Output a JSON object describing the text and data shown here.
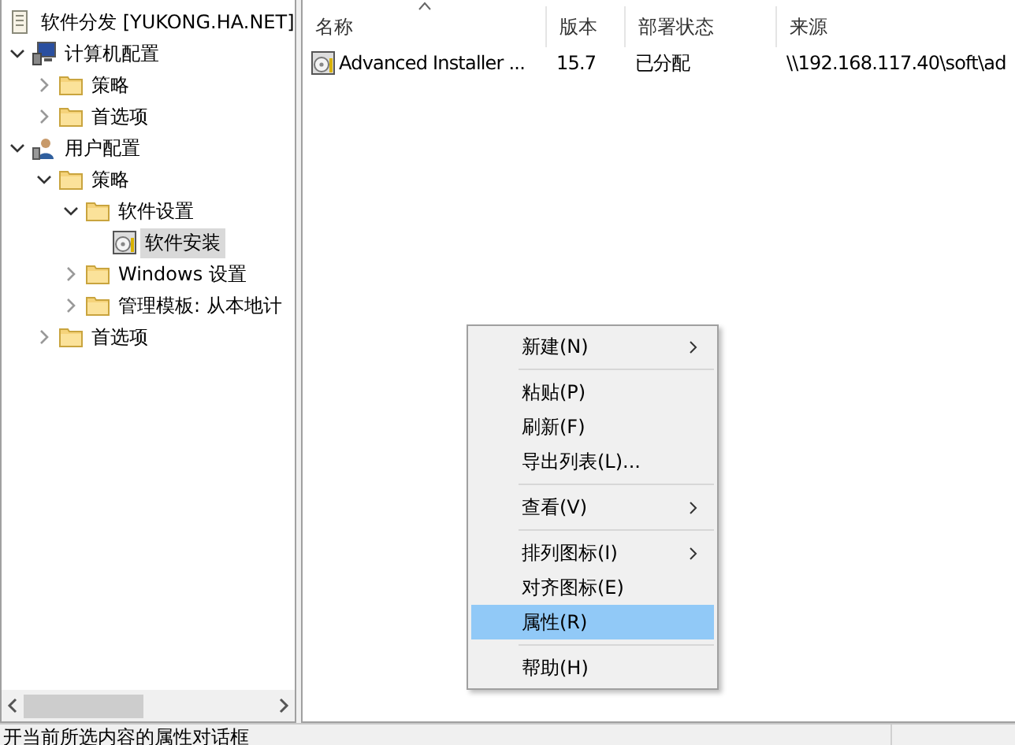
{
  "tree": {
    "label": "软件分发 [YUKONG.HA.NET]",
    "kind": "document",
    "children": [
      {
        "label": "计算机配置",
        "kind": "computer",
        "expanded": true,
        "selected": false,
        "children": [
          {
            "label": "策略",
            "kind": "folder",
            "expanded": false,
            "selected": false
          },
          {
            "label": "首选项",
            "kind": "folder",
            "expanded": false,
            "selected": false
          }
        ]
      },
      {
        "label": "用户配置",
        "kind": "user",
        "expanded": true,
        "selected": false,
        "children": [
          {
            "label": "策略",
            "kind": "folder",
            "expanded": true,
            "selected": false,
            "children": [
              {
                "label": "软件设置",
                "kind": "folder",
                "expanded": true,
                "selected": false,
                "children": [
                  {
                    "label": "软件安装",
                    "kind": "software",
                    "selected": true
                  }
                ]
              },
              {
                "label": "Windows 设置",
                "kind": "folder",
                "expanded": false,
                "selected": false
              },
              {
                "label": "管理模板: 从本地计",
                "kind": "folder",
                "expanded": false,
                "selected": false
              }
            ]
          },
          {
            "label": "首选项",
            "kind": "folder",
            "expanded": false,
            "selected": false
          }
        ]
      }
    ]
  },
  "table": {
    "columns": [
      {
        "label": "名称",
        "sorted": true
      },
      {
        "label": "版本",
        "sorted": false
      },
      {
        "label": "部署状态",
        "sorted": false
      },
      {
        "label": "来源",
        "sorted": false
      }
    ],
    "rows": [
      {
        "cells": [
          "Advanced Installer ...",
          "15.7",
          "已分配",
          "\\\\192.168.117.40\\soft\\ad"
        ]
      }
    ]
  },
  "context_menu": [
    {
      "kind": "item",
      "label": "新建(N)",
      "submenu": true,
      "selected": false
    },
    {
      "kind": "separator"
    },
    {
      "kind": "item",
      "label": "粘贴(P)",
      "submenu": false,
      "selected": false
    },
    {
      "kind": "item",
      "label": "刷新(F)",
      "submenu": false,
      "selected": false
    },
    {
      "kind": "item",
      "label": "导出列表(L)...",
      "submenu": false,
      "selected": false
    },
    {
      "kind": "separator"
    },
    {
      "kind": "item",
      "label": "查看(V)",
      "submenu": true,
      "selected": false
    },
    {
      "kind": "separator"
    },
    {
      "kind": "item",
      "label": "排列图标(I)",
      "submenu": true,
      "selected": false
    },
    {
      "kind": "item",
      "label": "对齐图标(E)",
      "submenu": false,
      "selected": false
    },
    {
      "kind": "item",
      "label": "属性(R)",
      "submenu": false,
      "selected": true
    },
    {
      "kind": "separator"
    },
    {
      "kind": "item",
      "label": "帮助(H)",
      "submenu": false,
      "selected": false
    }
  ],
  "status_bar": {
    "text": "开当前所选内容的属性对话框"
  }
}
